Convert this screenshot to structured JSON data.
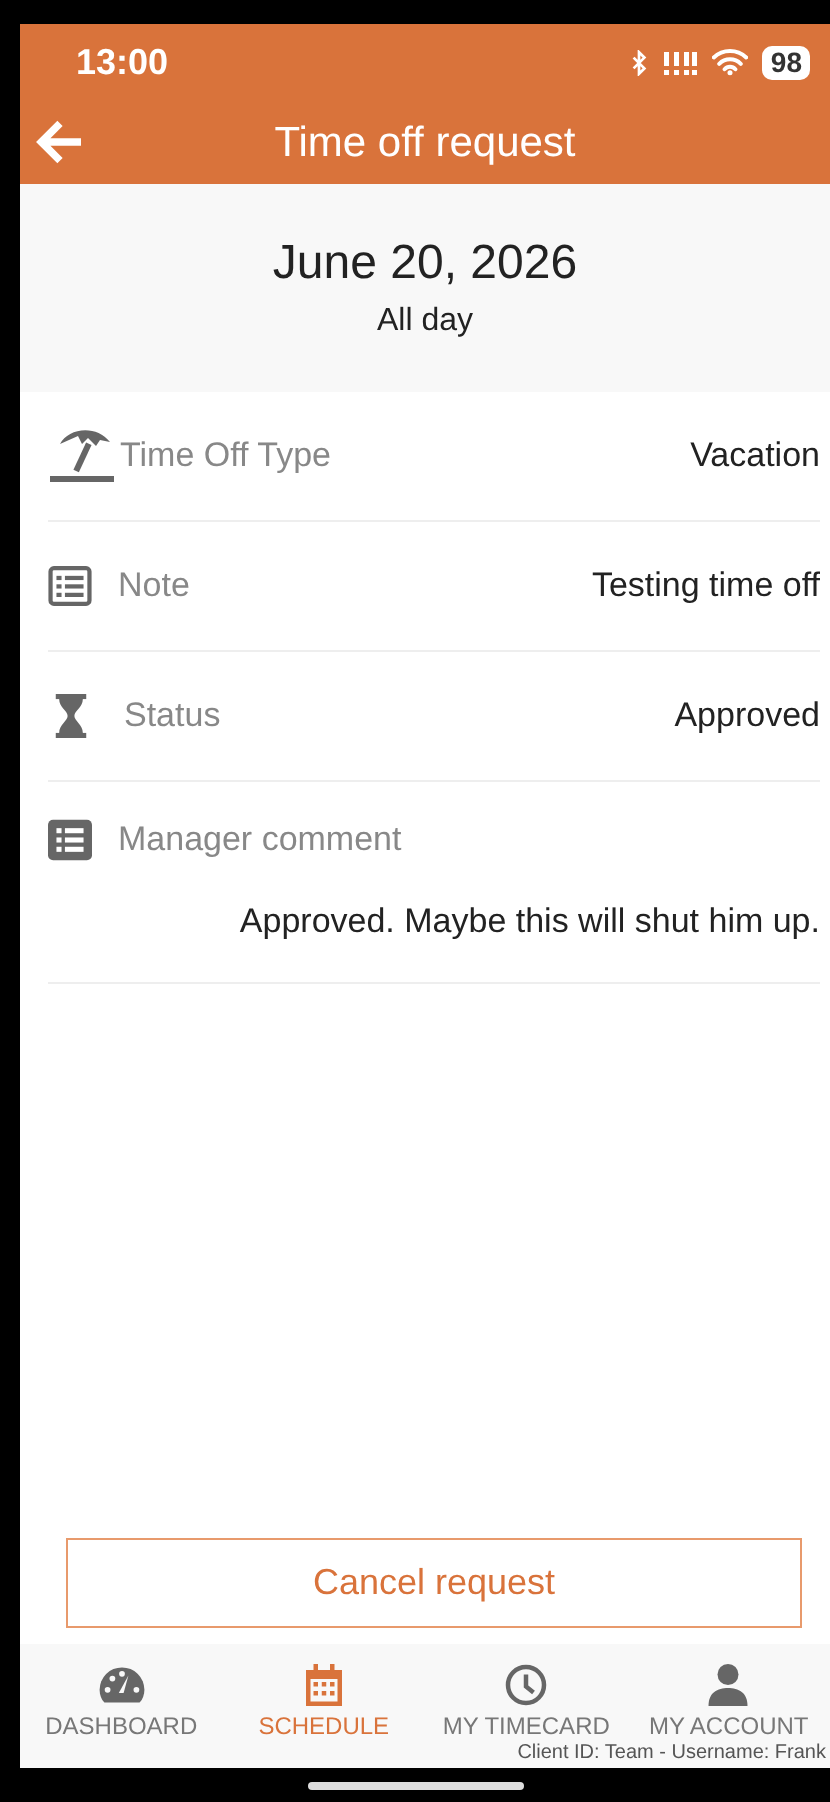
{
  "status_bar": {
    "time": "13:00",
    "battery": "98"
  },
  "header": {
    "title": "Time off request"
  },
  "summary": {
    "date": "June 20, 2026",
    "duration": "All day"
  },
  "details": [
    {
      "kind": "inline",
      "label": "Time Off Type",
      "value": "Vacation"
    },
    {
      "kind": "inline",
      "label": "Note",
      "value": "Testing time off"
    },
    {
      "kind": "inline",
      "label": "Status",
      "value": "Approved"
    },
    {
      "kind": "block",
      "label": "Manager comment",
      "value": "Approved. Maybe this will shut him up."
    }
  ],
  "action_button": {
    "label": "Cancel request"
  },
  "bottom_nav": [
    {
      "label": "DASHBOARD",
      "selected": false
    },
    {
      "label": "SCHEDULE",
      "selected": true
    },
    {
      "label": "MY TIMECARD",
      "selected": false
    },
    {
      "label": "MY ACCOUNT",
      "selected": false
    }
  ],
  "footer_overlay": "Client ID: Team - Username: Frank"
}
